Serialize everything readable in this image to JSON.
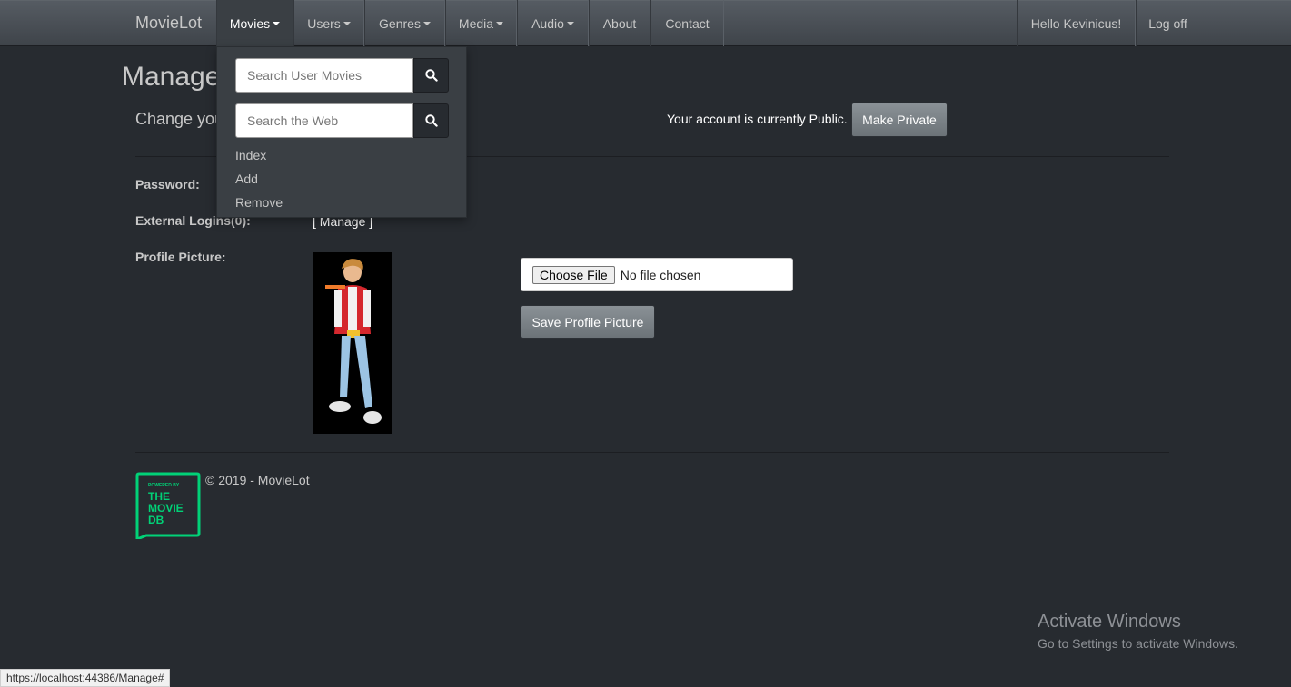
{
  "navbar": {
    "brand": "MovieLot",
    "items": [
      {
        "label": "Movies",
        "caret": true
      },
      {
        "label": "Users",
        "caret": true
      },
      {
        "label": "Genres",
        "caret": true
      },
      {
        "label": "Media",
        "caret": true
      },
      {
        "label": "Audio",
        "caret": true
      },
      {
        "label": "About",
        "caret": false
      },
      {
        "label": "Contact",
        "caret": false
      }
    ],
    "greeting": "Hello Kevinicus!",
    "logoff": "Log off"
  },
  "dropdown": {
    "search_user_placeholder": "Search User Movies",
    "search_web_placeholder": "Search the Web",
    "links": [
      "Index",
      "Add",
      "Remove"
    ]
  },
  "page": {
    "title": "Manage",
    "subtitle": "Change you",
    "account_status": "Your account is currently Public.",
    "make_private": "Make Private",
    "password_label": "Password:",
    "external_logins_label": "External Logins(0):",
    "manage_link": "[ Manage ]",
    "profile_picture_label": "Profile Picture:",
    "choose_file": "Choose File",
    "no_file": "No file chosen",
    "save_profile_picture": "Save Profile Picture"
  },
  "footer": {
    "tmdb_logo": [
      "POWERED BY",
      "THE",
      "MOVIE",
      "DB"
    ],
    "copyright": "© 2019 - MovieLot"
  },
  "windows": {
    "activate_title": "Activate Windows",
    "activate_sub": "Go to Settings to activate Windows."
  },
  "status_url": "https://localhost:44386/Manage#",
  "colors": {
    "background": "#272b30",
    "navbar": "#4f555b",
    "tmdb_green": "#01d277"
  }
}
